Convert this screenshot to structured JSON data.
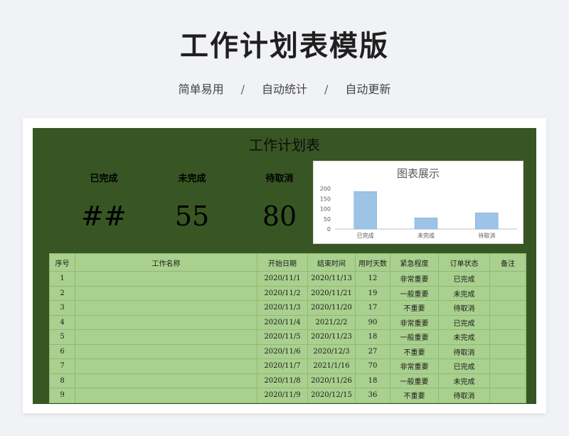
{
  "hero": {
    "title": "工作计划表模版",
    "features": [
      "简单易用",
      "自动统计",
      "自动更新"
    ],
    "separator": "/"
  },
  "sheet": {
    "title": "工作计划表",
    "stats": [
      {
        "label": "已完成",
        "value": "##"
      },
      {
        "label": "未完成",
        "value": "55"
      },
      {
        "label": "待取消",
        "value": "80"
      }
    ]
  },
  "chart_data": {
    "type": "bar",
    "title": "图表展示",
    "categories": [
      "已完成",
      "未完成",
      "待取消"
    ],
    "values": [
      185,
      55,
      80
    ],
    "ylim": [
      0,
      200
    ],
    "yticks": [
      0,
      50,
      100,
      150,
      200
    ],
    "bar_color": "#9dc3e6",
    "grid": false
  },
  "table": {
    "headers": [
      "序号",
      "工作名称",
      "开始日期",
      "结束时间",
      "用时天数",
      "紧急程度",
      "订单状态",
      "备注"
    ],
    "rows": [
      [
        "1",
        "",
        "2020/11/1",
        "2020/11/13",
        "12",
        "非常重要",
        "已完成",
        ""
      ],
      [
        "2",
        "",
        "2020/11/2",
        "2020/11/21",
        "19",
        "一般重要",
        "未完成",
        ""
      ],
      [
        "3",
        "",
        "2020/11/3",
        "2020/11/20",
        "17",
        "不重要",
        "待取消",
        ""
      ],
      [
        "4",
        "",
        "2020/11/4",
        "2021/2/2",
        "90",
        "非常重要",
        "已完成",
        ""
      ],
      [
        "5",
        "",
        "2020/11/5",
        "2020/11/23",
        "18",
        "一般重要",
        "未完成",
        ""
      ],
      [
        "6",
        "",
        "2020/11/6",
        "2020/12/3",
        "27",
        "不重要",
        "待取消",
        ""
      ],
      [
        "7",
        "",
        "2020/11/7",
        "2021/1/16",
        "70",
        "非常重要",
        "已完成",
        ""
      ],
      [
        "8",
        "",
        "2020/11/8",
        "2020/11/26",
        "18",
        "一般重要",
        "未完成",
        ""
      ],
      [
        "9",
        "",
        "2020/11/9",
        "2020/12/15",
        "36",
        "不重要",
        "待取消",
        ""
      ]
    ]
  },
  "colors": {
    "sheet_bg": "#375623",
    "table_bg": "#a9d08e",
    "page_bg": "#f1f2f5"
  }
}
